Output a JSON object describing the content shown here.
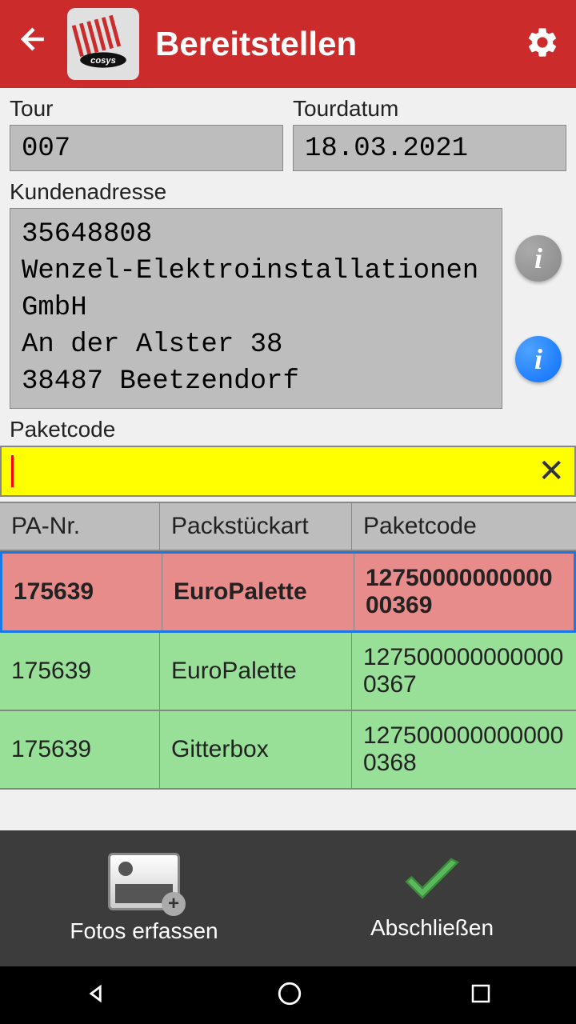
{
  "header": {
    "title": "Bereitstellen"
  },
  "tour": {
    "label": "Tour",
    "value": "007"
  },
  "tourdatum": {
    "label": "Tourdatum",
    "value": "18.03.2021"
  },
  "kundenadresse": {
    "label": "Kundenadresse",
    "value": "35648808\nWenzel-Elektroinstallationen GmbH\nAn der Alster 38\n38487 Beetzendorf"
  },
  "paketcode": {
    "label": "Paketcode",
    "value": ""
  },
  "table": {
    "headers": {
      "pa": "PA-Nr.",
      "art": "Packstückart",
      "code": "Paketcode"
    },
    "rows": [
      {
        "pa": "175639",
        "art": "EuroPalette",
        "code": "1275000000000000369",
        "status": "red"
      },
      {
        "pa": "175639",
        "art": "EuroPalette",
        "code": "1275000000000000367",
        "status": "green"
      },
      {
        "pa": "175639",
        "art": "Gitterbox",
        "code": "1275000000000000368",
        "status": "green"
      }
    ]
  },
  "bottom": {
    "fotos": "Fotos erfassen",
    "abschliessen": "Abschließen"
  }
}
